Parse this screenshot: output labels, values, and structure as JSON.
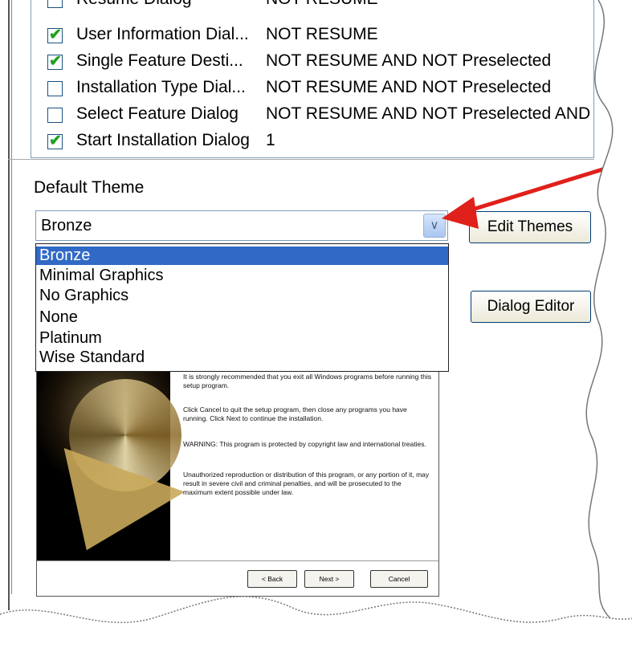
{
  "features": [
    {
      "name": "Resume Dialog",
      "condition": "NOT RESUME",
      "checked": false
    },
    {
      "name": "User Information Dial...",
      "condition": "NOT RESUME",
      "checked": true
    },
    {
      "name": "Single Feature Desti...",
      "condition": "NOT RESUME AND NOT Preselected",
      "checked": true
    },
    {
      "name": "Installation Type Dial...",
      "condition": "NOT RESUME AND NOT Preselected",
      "checked": false
    },
    {
      "name": "Select Feature Dialog",
      "condition": "NOT RESUME AND NOT Preselected AND In",
      "checked": false
    },
    {
      "name": "Start Installation Dialog",
      "condition": "1",
      "checked": true
    }
  ],
  "theme": {
    "label": "Default Theme",
    "selected": "Bronze",
    "options": [
      "Bronze",
      "Minimal Graphics",
      "No Graphics",
      "None",
      "Platinum",
      "Wise Standard"
    ]
  },
  "buttons": {
    "edit_themes": "Edit Themes",
    "dialog_editor": "Dialog Editor"
  },
  "preview": {
    "paragraphs": [
      "It is strongly recommended that you exit all Windows programs before running this setup program.",
      "Click Cancel to quit the setup program, then close any programs you have running.  Click Next to continue the installation.",
      "WARNING: This program is protected by copyright law and international treaties.",
      "Unauthorized reproduction or distribution of this program, or any portion of it, may result in severe civil and criminal penalties, and will be prosecuted to the maximum extent possible under law."
    ],
    "back": "< Back",
    "next": "Next >",
    "cancel": "Cancel"
  },
  "colors": {
    "selection": "#3169c6",
    "arrow": "#e0201a",
    "check": "#21a121"
  }
}
